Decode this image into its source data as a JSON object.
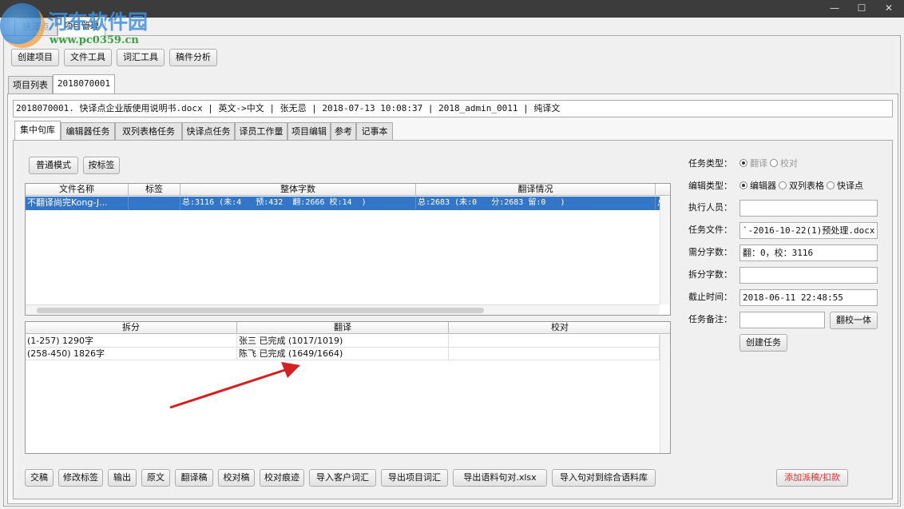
{
  "watermark": {
    "name": "河东软件园",
    "url": "www.pc0359.cn"
  },
  "window": {
    "controls": [
      "—",
      "☐",
      "✕"
    ]
  },
  "top_tabs": [
    {
      "label": "快译点"
    },
    {
      "label": "项目管理"
    }
  ],
  "toolbar": [
    "创建项目",
    "文件工具",
    "词汇工具",
    "稿件分析"
  ],
  "project_tabs": [
    {
      "label": "项目列表"
    },
    {
      "label": "2018070001"
    }
  ],
  "info_bar": "2018070001. 快译点企业版使用说明书.docx | 英文->中文 | 张无忌 | 2018-07-13 10:08:37 | 2018_admin_0011 | 纯译文",
  "sub_tabs": [
    "集中句库",
    "编辑器任务",
    "双列表格任务",
    "快译点任务",
    "译员工作量",
    "项目编辑",
    "参考",
    "记事本"
  ],
  "mode_buttons": [
    "普通模式",
    "按标签"
  ],
  "file_table": {
    "columns": [
      "文件名称",
      "标签",
      "整体字数",
      "翻译情况"
    ],
    "rows": [
      {
        "name": "不翻译尚完Kong-J...",
        "tag": "",
        "total": "总:3116 (未:4   预:432  翻:2666 校:14  )",
        "status": "总:2683 (未:0   分:2683 留:0   )",
        "extra": "总"
      }
    ]
  },
  "split_table": {
    "columns": [
      "拆分",
      "翻译",
      "校对"
    ],
    "rows": [
      {
        "split": "(1-257) 1290字",
        "translate": "张三 已完成 (1017/1019)",
        "proof": ""
      },
      {
        "split": "(258-450) 1826字",
        "translate": "陈飞 已完成 (1649/1664)",
        "proof": ""
      }
    ]
  },
  "form": {
    "task_type": {
      "label": "任务类型：",
      "options": [
        "翻译",
        "校对"
      ],
      "selected": 0
    },
    "edit_type": {
      "label": "编辑类型：",
      "options": [
        "编辑器",
        "双列表格",
        "快译点"
      ],
      "selected": 0
    },
    "executor": {
      "label": "执行人员：",
      "value": ""
    },
    "task_file": {
      "label": "任务文件：",
      "value": "`-2016-10-22(1)预处理.docx"
    },
    "need_words": {
      "label": "需分字数：",
      "value": "翻：0，校：3116"
    },
    "split_words": {
      "label": "拆分字数：",
      "value": ""
    },
    "deadline": {
      "label": "截止时间：",
      "value": "2018-06-11 22:48:55"
    },
    "note": {
      "label": "任务备注：",
      "value": "",
      "button": "翻校一体"
    },
    "create_button": "创建任务"
  },
  "bottom_buttons": [
    "交稿",
    "修改标签",
    "输出",
    "原文",
    "翻译稿",
    "校对稿",
    "校对痕迹",
    "导入客户词汇",
    "导出项目词汇",
    "导出语料句对.xlsx",
    "导入句对到综合语料库"
  ],
  "add_button": {
    "label": "添加派稿/扣款",
    "color": "#e03030"
  },
  "colors": {
    "selection": "#3375c6",
    "arrow": "#d42020"
  }
}
